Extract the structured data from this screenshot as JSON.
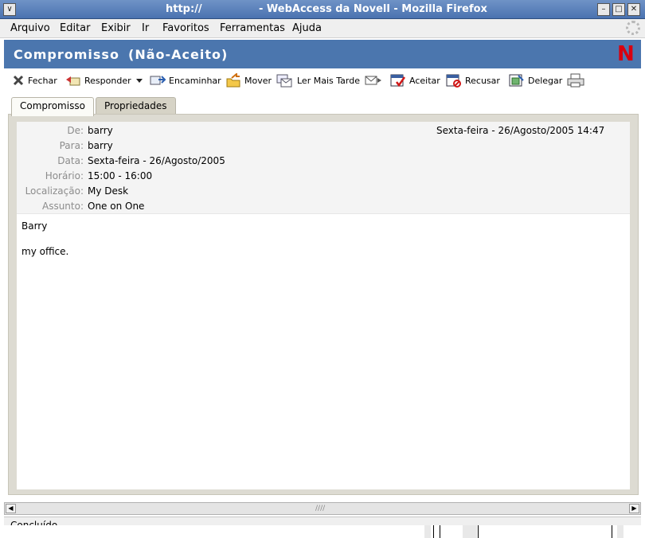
{
  "window": {
    "url": "http://",
    "title": "- WebAccess da Novell - Mozilla Firefox",
    "menu_glyph": "∨",
    "min_glyph": "–",
    "max_glyph": "□",
    "close_glyph": "✕"
  },
  "menubar": {
    "items": [
      "Arquivo",
      "Editar",
      "Exibir",
      "Ir",
      "Favoritos",
      "Ferramentas",
      "Ajuda"
    ]
  },
  "header": {
    "title": "Compromisso",
    "status": "(Não-Aceito)",
    "logo_text": "N",
    "bg_color": "#4b76ae"
  },
  "toolbar": {
    "fechar": "Fechar",
    "responder": "Responder",
    "encaminhar": "Encaminhar",
    "mover": "Mover",
    "ler_mais_tarde": "Ler Mais Tarde",
    "aceitar": "Aceitar",
    "recusar": "Recusar",
    "delegar": "Delegar",
    "icons": [
      "close-x-icon",
      "reply-icon",
      "chevron-down-icon",
      "forward-icon",
      "move-folder-icon",
      "read-later-icon",
      "send-mail-icon",
      "calendar-accept-icon",
      "calendar-decline-icon",
      "delegate-icon",
      "print-icon"
    ]
  },
  "tabs": [
    {
      "label": "Compromisso",
      "active": true
    },
    {
      "label": "Propriedades",
      "active": false
    }
  ],
  "message": {
    "de_label": "De:",
    "de": "barry",
    "date_sent": "Sexta-feira - 26/Agosto/2005 14:47",
    "para_label": "Para:",
    "para": "barry",
    "data_label": "Data:",
    "data": "Sexta-feira - 26/Agosto/2005",
    "horario_label": "Horário:",
    "horario": "15:00 - 16:00",
    "local_label": "Localização:",
    "local": "My Desk",
    "assunto_label": "Assunto:",
    "assunto": "One on One",
    "body_line1": "Barry",
    "body_line2": "my office."
  },
  "scrollbar": {
    "left_glyph": "◀",
    "right_glyph": "▶",
    "grip": "////"
  },
  "status": {
    "text": "Concluído"
  }
}
